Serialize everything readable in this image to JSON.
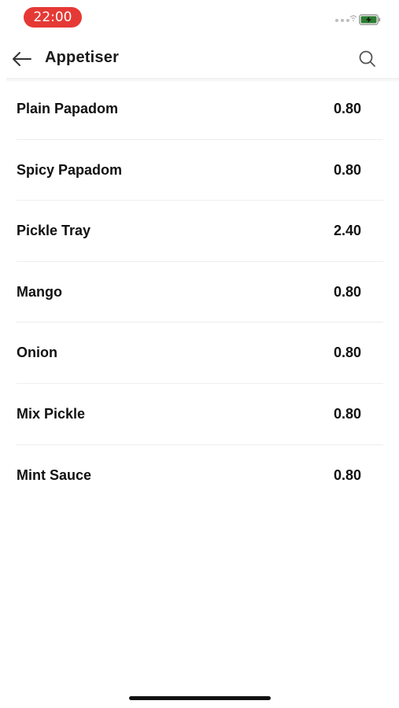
{
  "status_bar": {
    "time": "22:00",
    "time_bg_color": "#e53935",
    "battery_color": "#2e7d32",
    "icons": [
      "signal-icon",
      "wifi-icon",
      "battery-charging-icon"
    ]
  },
  "header": {
    "title": "Appetiser",
    "back_icon": "arrow-left-icon",
    "search_icon": "search-icon"
  },
  "menu": {
    "items": [
      {
        "name": "Plain Papadom",
        "price": "0.80"
      },
      {
        "name": "Spicy Papadom",
        "price": "0.80"
      },
      {
        "name": "Pickle Tray",
        "price": "2.40"
      },
      {
        "name": "Mango",
        "price": "0.80"
      },
      {
        "name": "Onion",
        "price": "0.80"
      },
      {
        "name": "Mix Pickle",
        "price": "0.80"
      },
      {
        "name": "Mint Sauce",
        "price": "0.80"
      }
    ]
  }
}
